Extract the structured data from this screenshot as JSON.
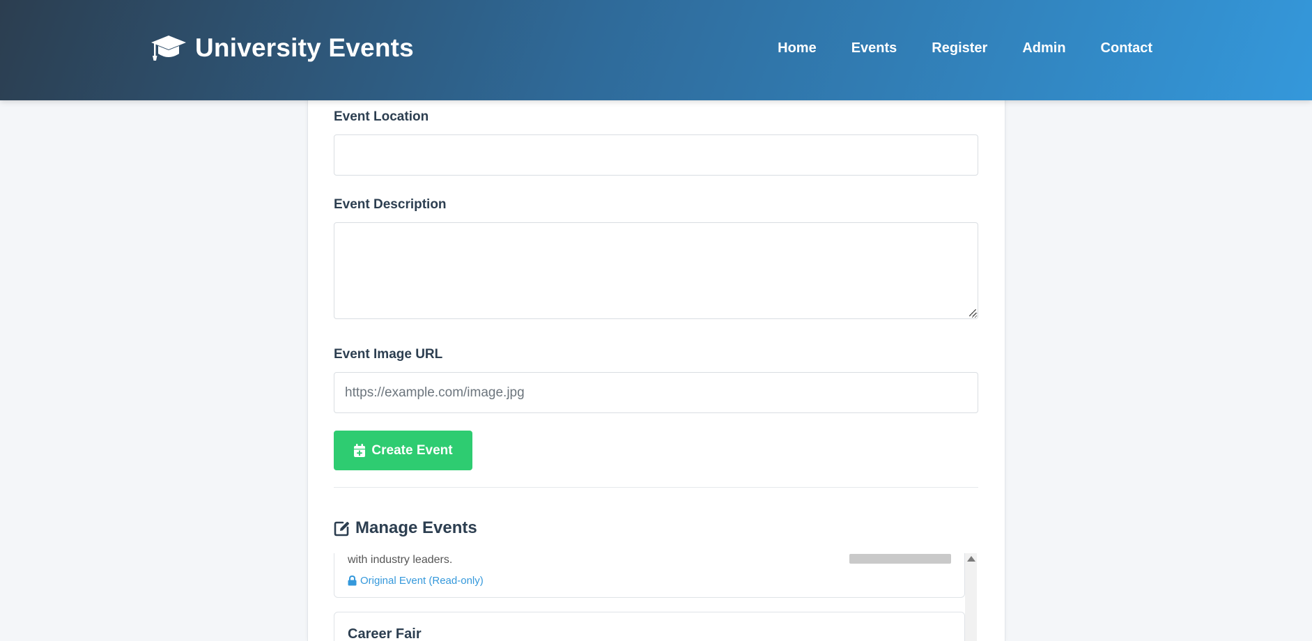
{
  "header": {
    "brand_icon": "graduation-cap-icon",
    "brand_title": "University Events",
    "nav": [
      "Home",
      "Events",
      "Register",
      "Admin",
      "Contact"
    ]
  },
  "form": {
    "location_label": "Event Location",
    "location_value": "",
    "description_label": "Event Description",
    "description_value": "",
    "image_url_label": "Event Image URL",
    "image_url_placeholder": "https://example.com/image.jpg",
    "create_button_icon": "calendar-plus-icon",
    "create_button": "Create Event"
  },
  "manage": {
    "title_icon": "edit-icon",
    "title": "Manage Events",
    "events": [
      {
        "description_fragment": "with industry leaders.",
        "badge_icon": "lock-icon",
        "badge": "Original Event (Read-only)"
      },
      {
        "title": "Career Fair"
      }
    ]
  },
  "colors": {
    "header_gradient_start": "#2c3e50",
    "header_gradient_end": "#3498db",
    "create_button": "#2ecc71",
    "badge": "#3498db",
    "text": "#2c3e50"
  }
}
